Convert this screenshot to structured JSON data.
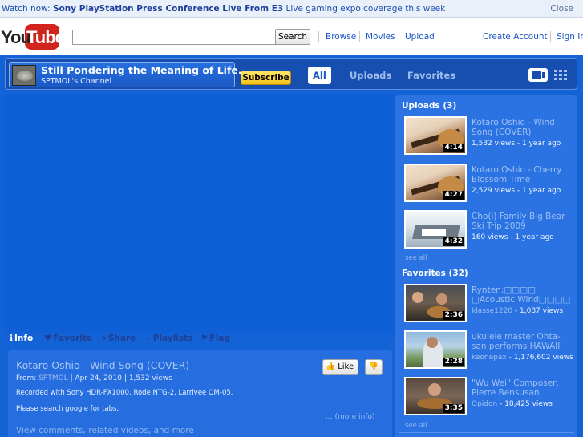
{
  "banner": {
    "lead": "Watch now:",
    "headline": "Sony PlayStation Press Conference Live From E3",
    "tail": "Live gaming expo coverage this week",
    "close": "Close"
  },
  "masthead": {
    "logo_you": "You",
    "logo_tube": "Tube",
    "search_value": "",
    "search_button": "Search",
    "nav": [
      "Browse",
      "Movies",
      "Upload"
    ],
    "create_account": "Create Account",
    "sign_in": "Sign In"
  },
  "channel": {
    "title": "Still Pondering the Meaning of Life...",
    "subtitle": "SPTMOL's Channel",
    "subscribe": "Subscribe",
    "tabs": [
      "All",
      "Uploads",
      "Favorites"
    ],
    "colors": {
      "background": "#1463d6",
      "header": "#164fb0",
      "subscribe": "#f6c21a"
    }
  },
  "info_tabs": [
    {
      "icon": "info-icon",
      "label": "Info"
    },
    {
      "icon": "heart-icon",
      "label": "Favorite"
    },
    {
      "icon": "share-arrow-icon",
      "label": "Share"
    },
    {
      "icon": "plus-icon",
      "label": "Playlists"
    },
    {
      "icon": "flag-icon",
      "label": "Flag"
    }
  ],
  "video": {
    "title": "Kotaro Oshio - Wind Song (COVER)",
    "from_label": "From:",
    "from_user": "SPTMOL",
    "date": "Apr 24, 2010",
    "views": "1,532 views",
    "like": "Like",
    "description_1": "Recorded with Sony HDR-FX1000, Rode NTG-2, Larrivee OM-05.",
    "description_2": "Please search google for tabs.",
    "more_info": "... (more info)",
    "view_comments": "View comments, related videos, and more"
  },
  "sidebar": {
    "uploads_heading": "Uploads (3)",
    "uploads": [
      {
        "title": "Kotaro Oshio - Wind Song (COVER)",
        "meta": "1,532 views - 1 year ago",
        "duration": "4:14"
      },
      {
        "title": "Kotaro Oshio - Cherry Blossom Time",
        "meta": "2,529 views - 1 year ago",
        "duration": "4:27"
      },
      {
        "title": "Cho(i) Family Big Bear Ski Trip 2009",
        "meta": "160 views - 1 year ago",
        "duration": "4:32"
      }
    ],
    "see_all_uploads": "see all",
    "favorites_heading": "Favorites (32)",
    "favorites": [
      {
        "title": "Rynten:□□□□ □Acoustic Wind□□□□",
        "user": "klasse1220",
        "meta": " - 1,087 views",
        "duration": "2:36"
      },
      {
        "title": "ukulele master Ohta-san performs HAWAII",
        "user": "keonepax",
        "meta": " - 1,176,602 views",
        "duration": "2:28"
      },
      {
        "title": "\"Wu Wei\" Composer: Pierre Bensusan",
        "user": "Opidon",
        "meta": " - 18,425 views",
        "duration": "3:35"
      }
    ],
    "see_all_favorites": "see all"
  }
}
